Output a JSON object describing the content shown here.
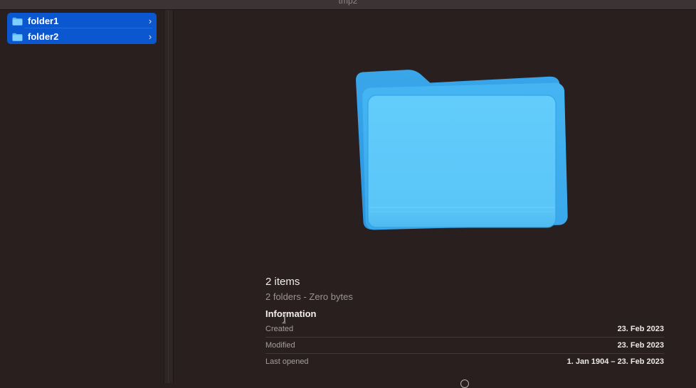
{
  "window": {
    "title": "tmp2"
  },
  "sidebar": {
    "items": [
      {
        "label": "folder1",
        "icon": "folder-icon",
        "chevron": "›"
      },
      {
        "label": "folder2",
        "icon": "folder-icon",
        "chevron": "›"
      }
    ]
  },
  "preview": {
    "icon": "large-folder-icon",
    "items_count": "2 items",
    "items_detail": "2 folders - Zero bytes",
    "info_heading": "Information",
    "meta": [
      {
        "key": "Created",
        "value": "23. Feb 2023"
      },
      {
        "key": "Modified",
        "value": "23. Feb 2023"
      },
      {
        "key": "Last opened",
        "value": "1. Jan 1904 – 23. Feb 2023"
      }
    ]
  },
  "colors": {
    "background": "#2a1f1f",
    "selection": "#0a57d0",
    "folder": "#5ac8fa"
  }
}
